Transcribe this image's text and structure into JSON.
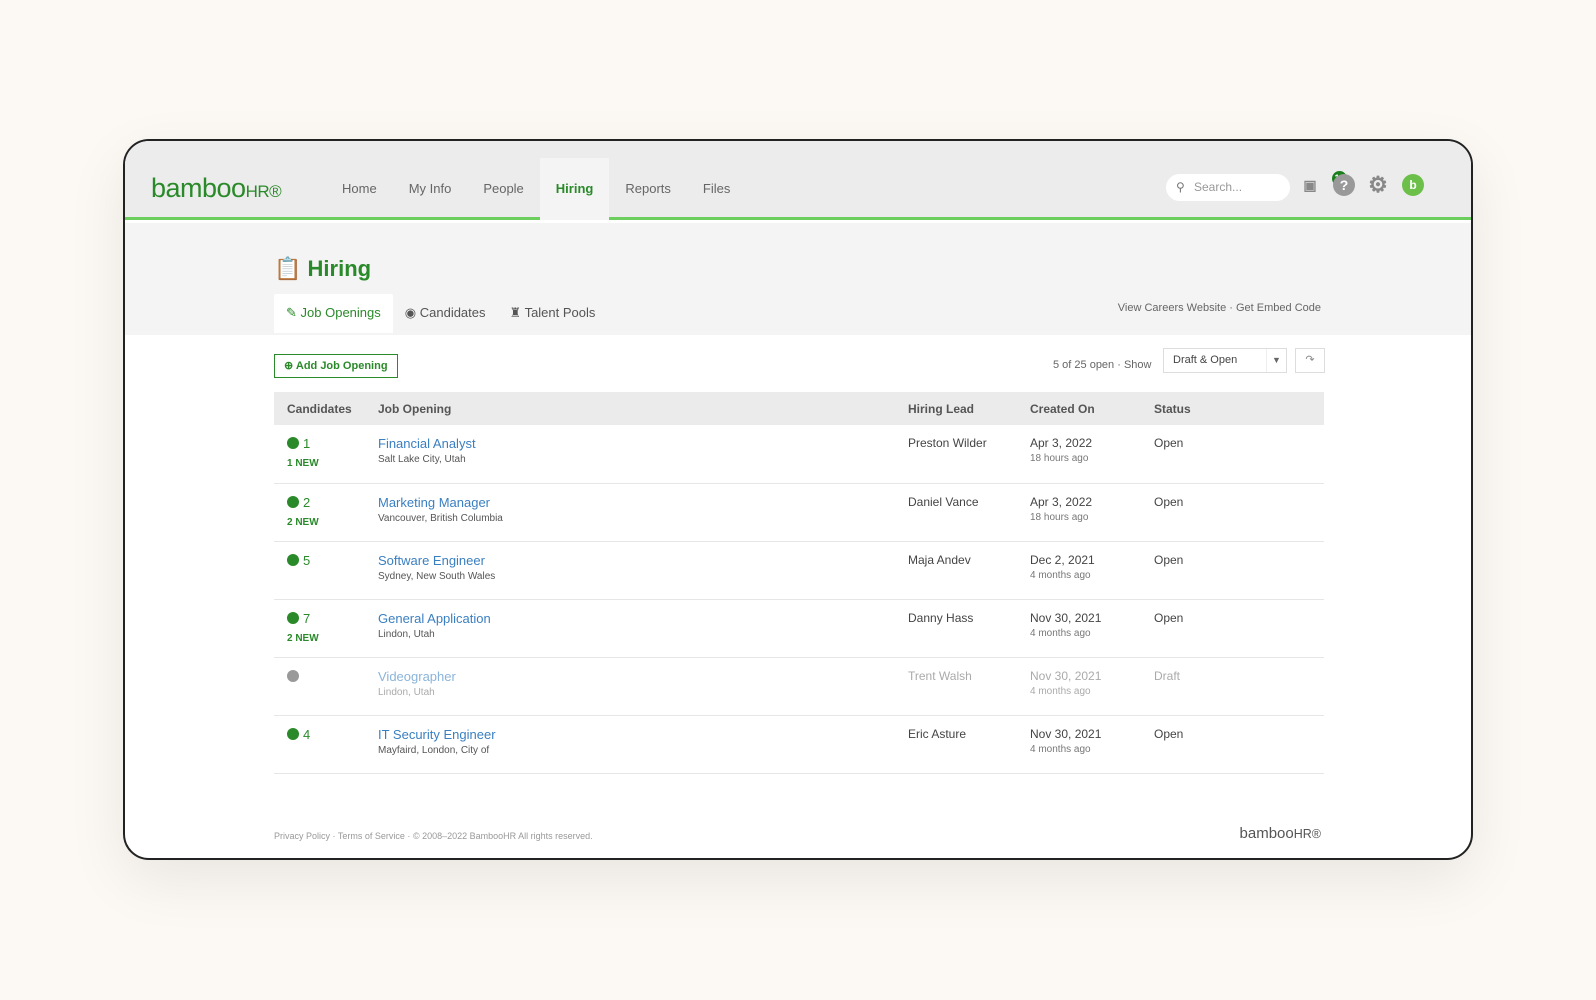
{
  "brand": {
    "logo": "bamboo",
    "logo_hr": "HR®"
  },
  "nav": [
    "Home",
    "My Info",
    "People",
    "Hiring",
    "Reports",
    "Files"
  ],
  "search": {
    "placeholder": "Search..."
  },
  "notifications": {
    "count": "12"
  },
  "page": {
    "title": "Hiring"
  },
  "tabs": [
    "Job Openings",
    "Candidates",
    "Talent Pools"
  ],
  "links": {
    "careers": "View Careers Website",
    "sep": "·",
    "embed": "Get Embed Code"
  },
  "toolbar": {
    "add": "Add Job Opening",
    "count": "5 of 25 open",
    "sep": "·",
    "show": "Show",
    "filter": "Draft & Open"
  },
  "table": {
    "headers": [
      "Candidates",
      "Job Opening",
      "Hiring Lead",
      "Created On",
      "Status"
    ],
    "rows": [
      {
        "count": "1",
        "new": "1 NEW",
        "title": "Financial Analyst",
        "location": "Salt Lake City, Utah",
        "lead": "Preston Wilder",
        "date": "Apr 3, 2022",
        "ago": "18 hours ago",
        "status": "Open"
      },
      {
        "count": "2",
        "new": "2 NEW",
        "title": "Marketing Manager",
        "location": "Vancouver, British Columbia",
        "lead": "Daniel Vance",
        "date": "Apr 3, 2022",
        "ago": "18 hours ago",
        "status": "Open"
      },
      {
        "count": "5",
        "new": "",
        "title": "Software Engineer",
        "location": "Sydney, New South Wales",
        "lead": "Maja Andev",
        "date": "Dec 2, 2021",
        "ago": "4 months ago",
        "status": "Open"
      },
      {
        "count": "7",
        "new": "2 NEW",
        "title": "General Application",
        "location": "Lindon, Utah",
        "lead": "Danny Hass",
        "date": "Nov 30, 2021",
        "ago": "4 months ago",
        "status": "Open"
      },
      {
        "count": "",
        "new": "",
        "title": "Videographer",
        "location": "Lindon, Utah",
        "lead": "Trent Walsh",
        "date": "Nov 30, 2021",
        "ago": "4 months ago",
        "status": "Draft"
      },
      {
        "count": "4",
        "new": "",
        "title": "IT Security Engineer",
        "location": "Mayfaird, London, City of",
        "lead": "Eric Asture",
        "date": "Nov 30, 2021",
        "ago": "4 months ago",
        "status": "Open"
      }
    ]
  },
  "footer": {
    "privacy": "Privacy Policy",
    "terms": "Terms of Service",
    "copyright": "© 2008–2022 BambooHR All rights reserved.",
    "sep": "·"
  },
  "colors": {
    "brand": "#2a8a2a",
    "accent_line": "#6ccf5d",
    "link": "#3a7fc1"
  }
}
